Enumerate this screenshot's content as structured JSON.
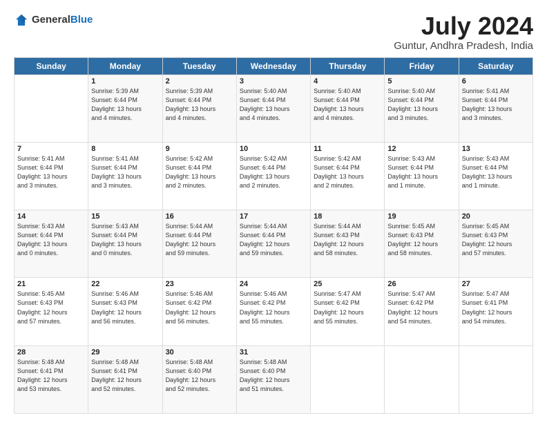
{
  "logo": {
    "text_general": "General",
    "text_blue": "Blue"
  },
  "header": {
    "month": "July 2024",
    "location": "Guntur, Andhra Pradesh, India"
  },
  "weekdays": [
    "Sunday",
    "Monday",
    "Tuesday",
    "Wednesday",
    "Thursday",
    "Friday",
    "Saturday"
  ],
  "weeks": [
    [
      {
        "day": "",
        "info": ""
      },
      {
        "day": "1",
        "info": "Sunrise: 5:39 AM\nSunset: 6:44 PM\nDaylight: 13 hours\nand 4 minutes."
      },
      {
        "day": "2",
        "info": "Sunrise: 5:39 AM\nSunset: 6:44 PM\nDaylight: 13 hours\nand 4 minutes."
      },
      {
        "day": "3",
        "info": "Sunrise: 5:40 AM\nSunset: 6:44 PM\nDaylight: 13 hours\nand 4 minutes."
      },
      {
        "day": "4",
        "info": "Sunrise: 5:40 AM\nSunset: 6:44 PM\nDaylight: 13 hours\nand 4 minutes."
      },
      {
        "day": "5",
        "info": "Sunrise: 5:40 AM\nSunset: 6:44 PM\nDaylight: 13 hours\nand 3 minutes."
      },
      {
        "day": "6",
        "info": "Sunrise: 5:41 AM\nSunset: 6:44 PM\nDaylight: 13 hours\nand 3 minutes."
      }
    ],
    [
      {
        "day": "7",
        "info": "Sunrise: 5:41 AM\nSunset: 6:44 PM\nDaylight: 13 hours\nand 3 minutes."
      },
      {
        "day": "8",
        "info": "Sunrise: 5:41 AM\nSunset: 6:44 PM\nDaylight: 13 hours\nand 3 minutes."
      },
      {
        "day": "9",
        "info": "Sunrise: 5:42 AM\nSunset: 6:44 PM\nDaylight: 13 hours\nand 2 minutes."
      },
      {
        "day": "10",
        "info": "Sunrise: 5:42 AM\nSunset: 6:44 PM\nDaylight: 13 hours\nand 2 minutes."
      },
      {
        "day": "11",
        "info": "Sunrise: 5:42 AM\nSunset: 6:44 PM\nDaylight: 13 hours\nand 2 minutes."
      },
      {
        "day": "12",
        "info": "Sunrise: 5:43 AM\nSunset: 6:44 PM\nDaylight: 13 hours\nand 1 minute."
      },
      {
        "day": "13",
        "info": "Sunrise: 5:43 AM\nSunset: 6:44 PM\nDaylight: 13 hours\nand 1 minute."
      }
    ],
    [
      {
        "day": "14",
        "info": "Sunrise: 5:43 AM\nSunset: 6:44 PM\nDaylight: 13 hours\nand 0 minutes."
      },
      {
        "day": "15",
        "info": "Sunrise: 5:43 AM\nSunset: 6:44 PM\nDaylight: 13 hours\nand 0 minutes."
      },
      {
        "day": "16",
        "info": "Sunrise: 5:44 AM\nSunset: 6:44 PM\nDaylight: 12 hours\nand 59 minutes."
      },
      {
        "day": "17",
        "info": "Sunrise: 5:44 AM\nSunset: 6:44 PM\nDaylight: 12 hours\nand 59 minutes."
      },
      {
        "day": "18",
        "info": "Sunrise: 5:44 AM\nSunset: 6:43 PM\nDaylight: 12 hours\nand 58 minutes."
      },
      {
        "day": "19",
        "info": "Sunrise: 5:45 AM\nSunset: 6:43 PM\nDaylight: 12 hours\nand 58 minutes."
      },
      {
        "day": "20",
        "info": "Sunrise: 5:45 AM\nSunset: 6:43 PM\nDaylight: 12 hours\nand 57 minutes."
      }
    ],
    [
      {
        "day": "21",
        "info": "Sunrise: 5:45 AM\nSunset: 6:43 PM\nDaylight: 12 hours\nand 57 minutes."
      },
      {
        "day": "22",
        "info": "Sunrise: 5:46 AM\nSunset: 6:43 PM\nDaylight: 12 hours\nand 56 minutes."
      },
      {
        "day": "23",
        "info": "Sunrise: 5:46 AM\nSunset: 6:42 PM\nDaylight: 12 hours\nand 56 minutes."
      },
      {
        "day": "24",
        "info": "Sunrise: 5:46 AM\nSunset: 6:42 PM\nDaylight: 12 hours\nand 55 minutes."
      },
      {
        "day": "25",
        "info": "Sunrise: 5:47 AM\nSunset: 6:42 PM\nDaylight: 12 hours\nand 55 minutes."
      },
      {
        "day": "26",
        "info": "Sunrise: 5:47 AM\nSunset: 6:42 PM\nDaylight: 12 hours\nand 54 minutes."
      },
      {
        "day": "27",
        "info": "Sunrise: 5:47 AM\nSunset: 6:41 PM\nDaylight: 12 hours\nand 54 minutes."
      }
    ],
    [
      {
        "day": "28",
        "info": "Sunrise: 5:48 AM\nSunset: 6:41 PM\nDaylight: 12 hours\nand 53 minutes."
      },
      {
        "day": "29",
        "info": "Sunrise: 5:48 AM\nSunset: 6:41 PM\nDaylight: 12 hours\nand 52 minutes."
      },
      {
        "day": "30",
        "info": "Sunrise: 5:48 AM\nSunset: 6:40 PM\nDaylight: 12 hours\nand 52 minutes."
      },
      {
        "day": "31",
        "info": "Sunrise: 5:48 AM\nSunset: 6:40 PM\nDaylight: 12 hours\nand 51 minutes."
      },
      {
        "day": "",
        "info": ""
      },
      {
        "day": "",
        "info": ""
      },
      {
        "day": "",
        "info": ""
      }
    ]
  ]
}
